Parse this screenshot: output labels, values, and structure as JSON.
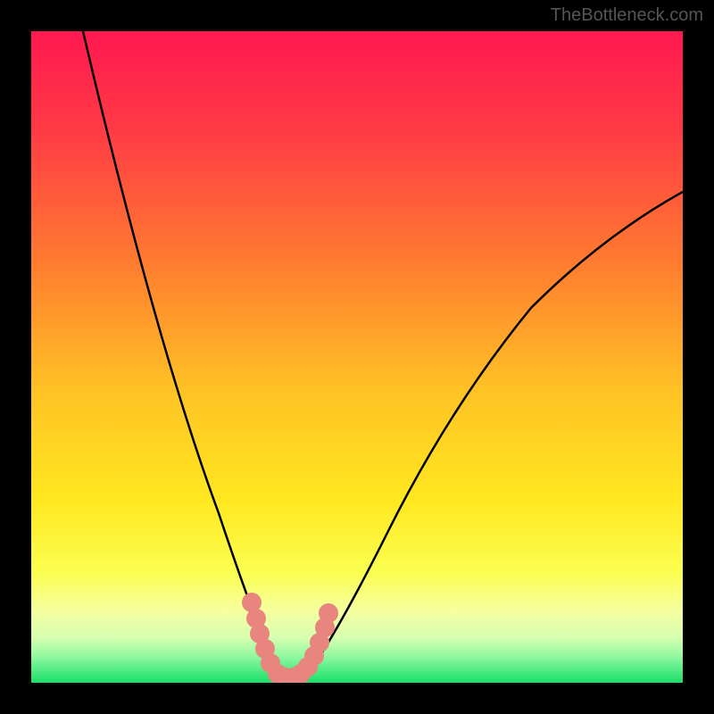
{
  "watermark": "TheBottleneck.com",
  "chart_data": {
    "type": "line",
    "title": "",
    "xlabel": "",
    "ylabel": "",
    "xlim": [
      0,
      100
    ],
    "ylim": [
      0,
      100
    ],
    "curve": {
      "description": "V-shaped bottleneck curve",
      "minimum_x": 38,
      "minimum_y": 0,
      "left_branch": [
        {
          "x": 8,
          "y": 100
        },
        {
          "x": 15,
          "y": 78
        },
        {
          "x": 22,
          "y": 55
        },
        {
          "x": 28,
          "y": 35
        },
        {
          "x": 32,
          "y": 20
        },
        {
          "x": 35,
          "y": 8
        },
        {
          "x": 37,
          "y": 2
        },
        {
          "x": 38,
          "y": 0
        }
      ],
      "right_branch": [
        {
          "x": 38,
          "y": 0
        },
        {
          "x": 42,
          "y": 2
        },
        {
          "x": 46,
          "y": 8
        },
        {
          "x": 52,
          "y": 20
        },
        {
          "x": 60,
          "y": 35
        },
        {
          "x": 70,
          "y": 50
        },
        {
          "x": 82,
          "y": 62
        },
        {
          "x": 100,
          "y": 75
        }
      ]
    },
    "highlighted_points": [
      {
        "x": 33.5,
        "y": 12
      },
      {
        "x": 34.5,
        "y": 8
      },
      {
        "x": 35,
        "y": 5
      },
      {
        "x": 36,
        "y": 2
      },
      {
        "x": 37,
        "y": 1
      },
      {
        "x": 38,
        "y": 0.5
      },
      {
        "x": 39,
        "y": 0.5
      },
      {
        "x": 40,
        "y": 0.5
      },
      {
        "x": 41,
        "y": 1
      },
      {
        "x": 42,
        "y": 2
      },
      {
        "x": 43,
        "y": 4
      },
      {
        "x": 44,
        "y": 7
      },
      {
        "x": 45,
        "y": 10
      }
    ],
    "gradient_colors": {
      "top": "#ff1850",
      "upper_mid": "#ff6830",
      "mid": "#ffd820",
      "lower_mid": "#f8ff60",
      "bottom": "#20e878"
    }
  }
}
